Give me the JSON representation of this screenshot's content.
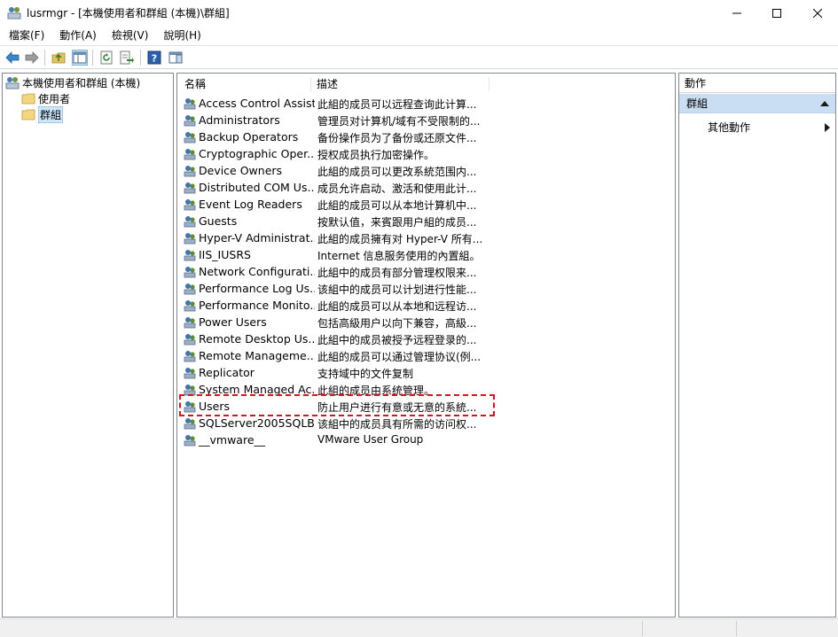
{
  "window": {
    "title": "lusrmgr - [本機使用者和群組 (本機)\\群組]",
    "app_icon": "users-group-icon"
  },
  "menu": [
    "檔案(F)",
    "動作(A)",
    "檢視(V)",
    "說明(H)"
  ],
  "toolbar": {
    "icons": [
      "back-arrow-icon",
      "forward-arrow-icon",
      "up-folder-icon",
      "show-hide-tree-icon",
      "refresh-icon",
      "export-list-icon",
      "help-icon",
      "properties-icon"
    ]
  },
  "tree": {
    "root": "本機使用者和群組 (本機)",
    "users": "使用者",
    "groups": "群組"
  },
  "list": {
    "columns": {
      "name": "名稱",
      "description": "描述"
    },
    "rows": [
      {
        "name": "Access Control Assist...",
        "description": "此組的成员可以远程查询此计算..."
      },
      {
        "name": "Administrators",
        "description": "管理员对计算机/域有不受限制的..."
      },
      {
        "name": "Backup Operators",
        "description": "备份操作员为了备份或还原文件..."
      },
      {
        "name": "Cryptographic Oper...",
        "description": "授权成员执行加密操作。"
      },
      {
        "name": "Device Owners",
        "description": "此組的成员可以更改系統范围内..."
      },
      {
        "name": "Distributed COM Us...",
        "description": "成员允许启动、激活和使用此计..."
      },
      {
        "name": "Event Log Readers",
        "description": "此組的成员可以从本地计算机中..."
      },
      {
        "name": "Guests",
        "description": "按默认值，来賓跟用户組的成员..."
      },
      {
        "name": "Hyper-V Administrat...",
        "description": "此組的成员擁有对 Hyper-V 所有..."
      },
      {
        "name": "IIS_IUSRS",
        "description": "Internet 信息服务使用的內置組。"
      },
      {
        "name": "Network Configurati...",
        "description": "此組中的成员有部分管理权限来..."
      },
      {
        "name": "Performance Log Us...",
        "description": "该組中的成员可以计划进行性能..."
      },
      {
        "name": "Performance Monito...",
        "description": "此組的成员可以从本地和远程访..."
      },
      {
        "name": "Power Users",
        "description": "包括高級用户以向下兼容，高級..."
      },
      {
        "name": "Remote Desktop Us...",
        "description": "此組中的成员被授予远程登录的..."
      },
      {
        "name": "Remote Manageme...",
        "description": "此組的成员可以通过管理协议(例..."
      },
      {
        "name": "Replicator",
        "description": "支持域中的文件复制"
      },
      {
        "name": "System Managed Ac...",
        "description": "此組的成员由系统管理。"
      },
      {
        "name": "Users",
        "description": "防止用户进行有意或无意的系統..."
      },
      {
        "name": "SQLServer2005SQLB...",
        "description": "该組中的成员具有所需的访问权..."
      },
      {
        "name": "__vmware__",
        "description": "VMware User Group"
      }
    ]
  },
  "actions": {
    "header": "動作",
    "group": "群組",
    "more": "其他動作"
  },
  "colors": {
    "highlight_border": "#d9141e",
    "action_group_bg": "#c9ddf3",
    "selection_bg": "#cce8ff"
  }
}
